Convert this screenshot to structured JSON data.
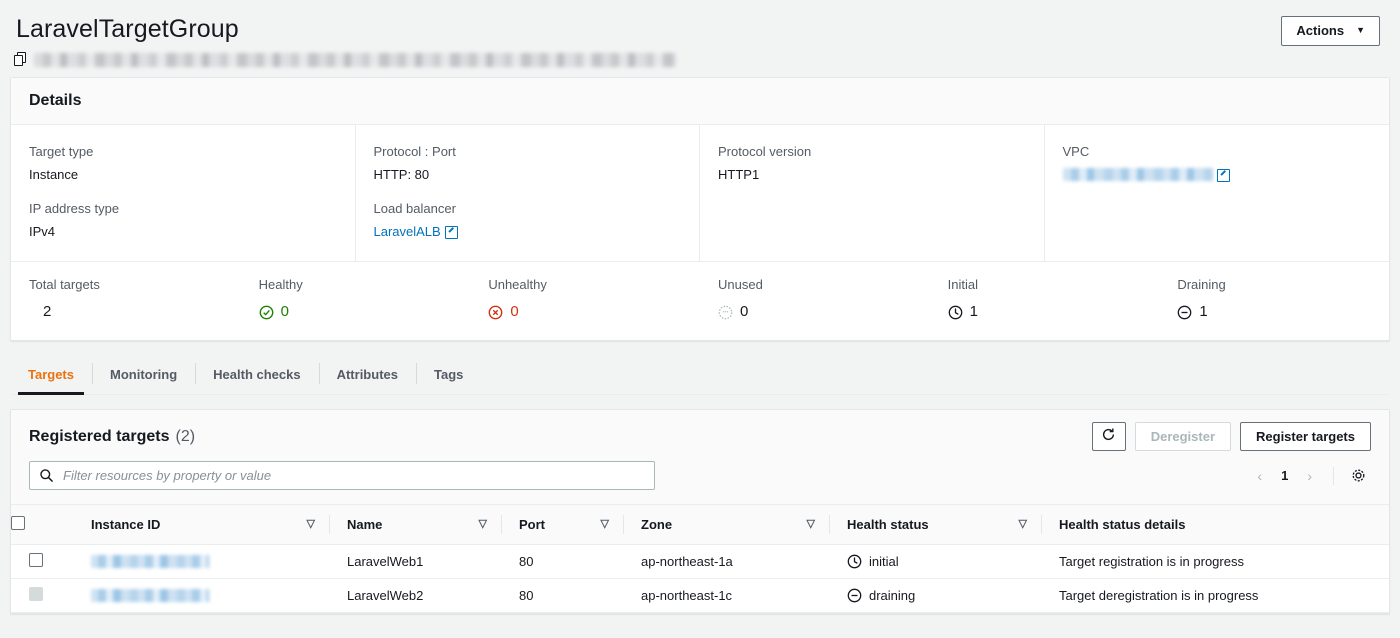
{
  "header": {
    "title": "LaravelTargetGroup",
    "actions_label": "Actions",
    "arn_masked": true
  },
  "details": {
    "heading": "Details",
    "fields": [
      {
        "label": "Target type",
        "value": "Instance"
      },
      {
        "label": "IP address type",
        "value": "IPv4"
      },
      {
        "label": "Protocol : Port",
        "value": "HTTP: 80"
      },
      {
        "label": "Load balancer",
        "value": "LaravelALB",
        "is_link": true
      },
      {
        "label": "Protocol version",
        "value": "HTTP1"
      },
      {
        "label": "VPC",
        "value": "",
        "is_link": true,
        "masked": true
      }
    ],
    "metrics": [
      {
        "label": "Total targets",
        "value": "2",
        "icon": "none"
      },
      {
        "label": "Healthy",
        "value": "0",
        "icon": "check-circle-icon",
        "color": "#1d8102"
      },
      {
        "label": "Unhealthy",
        "value": "0",
        "icon": "x-circle-icon",
        "color": "#d13212"
      },
      {
        "label": "Unused",
        "value": "0",
        "icon": "dotted-circle-icon",
        "color": "#879196"
      },
      {
        "label": "Initial",
        "value": "1",
        "icon": "clock-icon",
        "color": "#16191f"
      },
      {
        "label": "Draining",
        "value": "1",
        "icon": "minus-circle-icon",
        "color": "#16191f"
      }
    ]
  },
  "tabs": [
    {
      "label": "Targets",
      "active": true
    },
    {
      "label": "Monitoring",
      "active": false
    },
    {
      "label": "Health checks",
      "active": false
    },
    {
      "label": "Attributes",
      "active": false
    },
    {
      "label": "Tags",
      "active": false
    }
  ],
  "targets": {
    "title": "Registered targets",
    "count": "(2)",
    "refresh_label": "",
    "deregister_label": "Deregister",
    "register_label": "Register targets",
    "filter_placeholder": "Filter resources by property or value",
    "filter_value": "",
    "page_number": "1",
    "columns": [
      "Instance ID",
      "Name",
      "Port",
      "Zone",
      "Health status",
      "Health status details"
    ],
    "rows": [
      {
        "instance_id_masked": true,
        "name": "LaravelWeb1",
        "port": "80",
        "zone": "ap-northeast-1a",
        "health_status": "initial",
        "health_icon": "clock-icon",
        "details": "Target registration is in progress",
        "checkbox_disabled": false
      },
      {
        "instance_id_masked": true,
        "name": "LaravelWeb2",
        "port": "80",
        "zone": "ap-northeast-1c",
        "health_status": "draining",
        "health_icon": "minus-circle-icon",
        "details": "Target deregistration is in progress",
        "checkbox_disabled": true
      }
    ]
  },
  "colors": {
    "accent": "#ec7211",
    "link": "#0073bb",
    "healthy": "#1d8102",
    "unhealthy": "#d13212",
    "muted": "#545b64"
  }
}
